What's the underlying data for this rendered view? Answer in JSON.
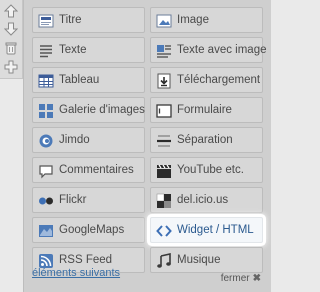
{
  "sidebar": {
    "tools": [
      "arrow-up-icon",
      "arrow-down-icon",
      "trash-icon",
      "move-icon"
    ]
  },
  "widgets": {
    "items": [
      {
        "label": "Titre",
        "icon": "title-icon"
      },
      {
        "label": "Image",
        "icon": "image-icon"
      },
      {
        "label": "Texte",
        "icon": "text-icon"
      },
      {
        "label": "Texte avec image",
        "icon": "text-image-icon"
      },
      {
        "label": "Tableau",
        "icon": "table-icon"
      },
      {
        "label": "Téléchargement",
        "icon": "download-icon"
      },
      {
        "label": "Galerie d'images",
        "icon": "gallery-icon"
      },
      {
        "label": "Formulaire",
        "icon": "form-icon"
      },
      {
        "label": "Jimdo",
        "icon": "jimdo-icon"
      },
      {
        "label": "Séparation",
        "icon": "separator-icon"
      },
      {
        "label": "Commentaires",
        "icon": "comments-icon"
      },
      {
        "label": "YouTube etc.",
        "icon": "video-icon"
      },
      {
        "label": "Flickr",
        "icon": "flickr-icon"
      },
      {
        "label": "del.icio.us",
        "icon": "delicious-icon"
      },
      {
        "label": "GoogleMaps",
        "icon": "map-icon"
      },
      {
        "label": "Widget / HTML",
        "icon": "code-icon"
      },
      {
        "label": "RSS Feed",
        "icon": "rss-icon"
      },
      {
        "label": "Musique",
        "icon": "music-icon"
      }
    ],
    "highlighted": "Widget / HTML"
  },
  "footer": {
    "next_label": "éléments suivants",
    "close_label": "fermer",
    "close_icon": "close-icon"
  },
  "colors": {
    "panel_bg": "#cfcfcf",
    "button_bg": "#d7d7d7",
    "highlight_bg": "#f4f7fa",
    "link": "#3a6fa6"
  }
}
